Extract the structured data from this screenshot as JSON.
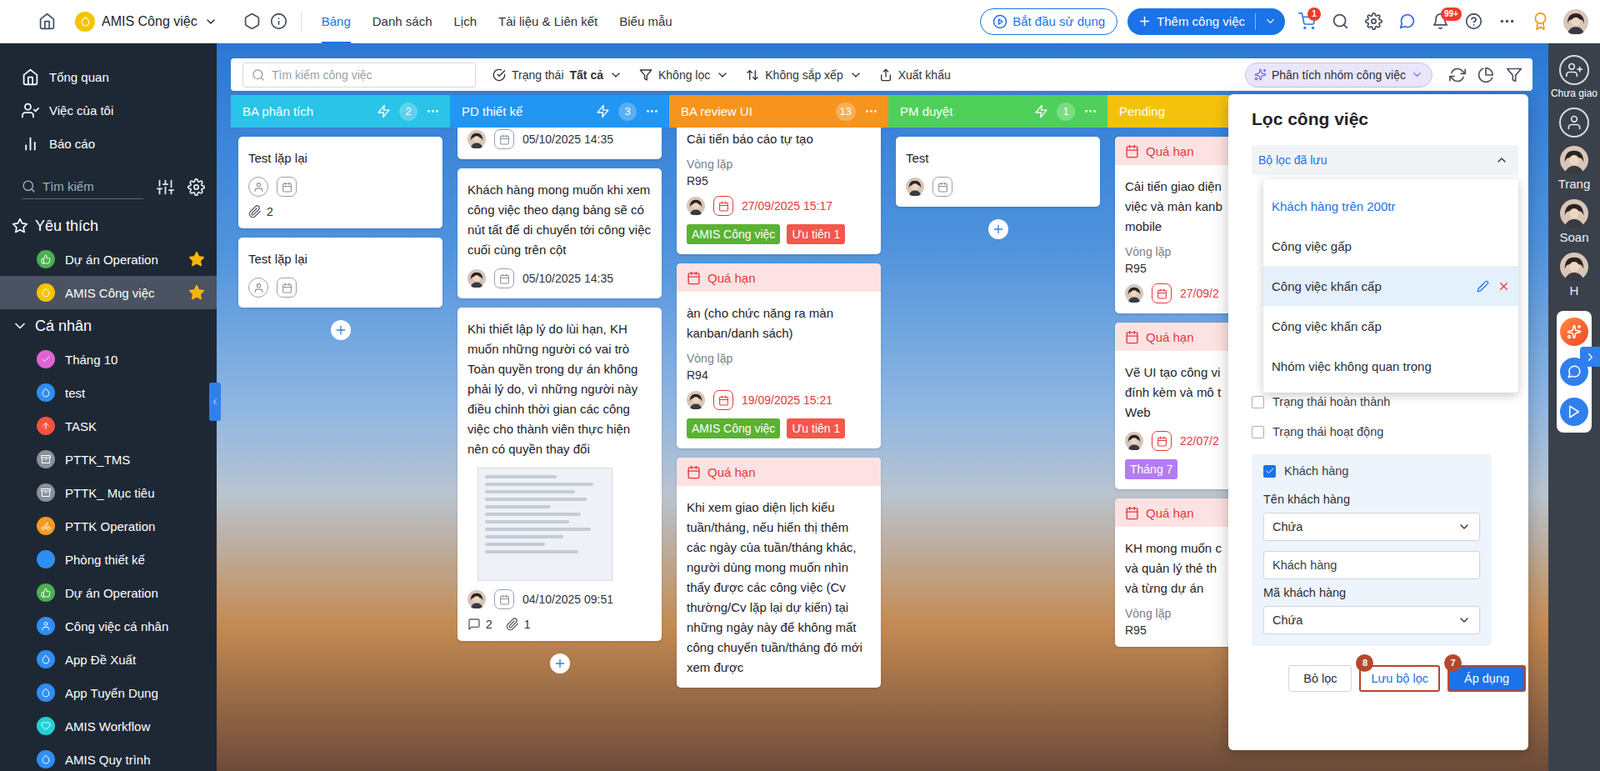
{
  "topbar": {
    "app_name": "AMIS Công việc",
    "tabs": [
      {
        "label": "Bảng",
        "selected": true
      },
      {
        "label": "Danh sách",
        "selected": false
      },
      {
        "label": "Lịch",
        "selected": false
      },
      {
        "label": "Tài liệu & Liên kết",
        "selected": false
      },
      {
        "label": "Biểu mẫu",
        "selected": false
      }
    ],
    "start_button": "Bắt đầu sử dụng",
    "add_button": "Thêm công việc",
    "cart_badge": "1",
    "notification_badge": "99+"
  },
  "sidebar": {
    "nav": [
      {
        "label": "Tổng quan",
        "kind": "home",
        "selected": false
      },
      {
        "label": "Việc của tôi",
        "kind": "mine",
        "selected": false
      },
      {
        "label": "Báo cáo",
        "kind": "report",
        "selected": false
      }
    ],
    "search_placeholder": "Tìm kiếm",
    "favorites": {
      "title": "Yêu thích",
      "items": [
        {
          "label": "Dự án Operation",
          "kind": "thumb",
          "color": "#4caf50",
          "starred": true,
          "selected": false
        },
        {
          "label": "AMIS Công việc",
          "kind": "drop",
          "color": "#f5c400",
          "starred": true,
          "selected": true
        }
      ]
    },
    "personal": {
      "title": "Cá nhân",
      "expanded": true,
      "items": [
        {
          "label": "Tháng 10",
          "kind": "check",
          "color": "#e062d6",
          "selected": false
        },
        {
          "label": "test",
          "kind": "drop",
          "color": "#2f8ef4",
          "selected": false
        },
        {
          "label": "TASK",
          "kind": "up",
          "color": "#f4533f",
          "selected": false
        },
        {
          "label": "PTTK_TMS",
          "kind": "box",
          "color": "#8b919b",
          "selected": false
        },
        {
          "label": "PTTK_ Mục tiêu",
          "kind": "box",
          "color": "#8b919b",
          "selected": false
        },
        {
          "label": "PTTK Operation",
          "kind": "bike",
          "color": "#f59a23",
          "selected": false
        },
        {
          "label": "Phòng thiết kế",
          "kind": "dot",
          "color": "#2f8ef4",
          "selected": false
        },
        {
          "label": "Dự án Operation",
          "kind": "thumb",
          "color": "#4caf50",
          "selected": false
        },
        {
          "label": "Công việc cá nhân",
          "kind": "person",
          "color": "#2f8ef4",
          "selected": false
        },
        {
          "label": "App Đề Xuất",
          "kind": "drop",
          "color": "#2f8ef4",
          "selected": false
        },
        {
          "label": "App Tuyển Dụng",
          "kind": "drop",
          "color": "#2f8ef4",
          "selected": false
        },
        {
          "label": "AMIS Workflow",
          "kind": "heart",
          "color": "#22cfd6",
          "selected": false
        },
        {
          "label": "AMIS Quy trình",
          "kind": "drop",
          "color": "#2f8ef4",
          "selected": false
        }
      ]
    }
  },
  "toolbar": {
    "search_placeholder": "Tìm kiếm công việc",
    "status_label": "Trạng thái",
    "status_value": "Tất cả",
    "filter": "Không lọc",
    "sort": "Không sắp xếp",
    "export": "Xuất khẩu",
    "analysis": "Phân tích nhóm công việc"
  },
  "columns": [
    {
      "title": "BA phân tích",
      "color": "#29c4e8",
      "automation": true,
      "count": "2",
      "add_button": true,
      "cards": [
        {
          "title": "Test lặp lại",
          "assignee": false,
          "attachments": "2"
        },
        {
          "title": "Test lặp lại",
          "assignee": false
        }
      ]
    },
    {
      "title": "PD thiết kế",
      "color": "#2196f3",
      "automation": true,
      "count": "3",
      "add_button": true,
      "cards": [
        {
          "cut_top": true,
          "assignee": true,
          "date": "05/10/2025 14:35",
          "date_overdue": false
        },
        {
          "title": "Khách hàng mong muốn khi xem công việc theo dạng bảng sẽ có nút tất để di chuyển tới công việc cuối cùng trên cột",
          "assignee": true,
          "date": "05/10/2025 14:35",
          "date_overdue": false
        },
        {
          "title": "Khi thiết lập lý do lùi hạn, KH muốn những người có vai trò Toàn quyền trong dự án không phải lý do, vì những người này điều chỉnh thời gian các công việc cho thành viên thực hiện nên có quyền thay đổi",
          "image": true,
          "assignee": true,
          "date": "04/10/2025 09:51",
          "date_overdue": false,
          "comments": "2",
          "attachments": "1"
        }
      ]
    },
    {
      "title": "BA review UI",
      "color": "#f7941d",
      "automation": false,
      "count": "13",
      "add_button": false,
      "cards": [
        {
          "cut_top": true,
          "title": "Cải tiến báo cáo tự tạo",
          "repeat_label": "Vòng lặp",
          "repeat_value": "R95",
          "assignee": true,
          "date": "27/09/2025 15:17",
          "date_overdue": true,
          "tags": [
            {
              "label": "AMIS Công việc",
              "color": "#5bb131"
            },
            {
              "label": "Ưu tiên 1",
              "color": "#f4574c"
            }
          ]
        },
        {
          "overdue_label": "Quá hạn",
          "title": "àn  (cho chức năng ra màn kanban/danh sách)",
          "repeat_label": "Vòng lặp",
          "repeat_value": "R94",
          "assignee": true,
          "date": "19/09/2025 15:21",
          "date_overdue": true,
          "tags": [
            {
              "label": "AMIS Công việc",
              "color": "#5bb131"
            },
            {
              "label": "Ưu tiên 1",
              "color": "#f4574c"
            }
          ]
        },
        {
          "overdue_label": "Quá hạn",
          "title": "Khi xem giao diện lịch kiểu tuần/tháng, nếu hiển thị thêm các ngày của tuần/tháng khác, người dùng mong muốn nhìn thấy được các công việc (Cv thường/Cv lặp lại dự kiến) tại những ngày này để không mất công chuyển tuần/tháng đó mới xem được"
        }
      ]
    },
    {
      "title": "PM duyệt",
      "color": "#4fd05a",
      "automation": true,
      "count": "1",
      "add_button": true,
      "cards": [
        {
          "title": "Test",
          "assignee": true
        }
      ]
    },
    {
      "title": "Pending",
      "color": "#f4c20d",
      "automation": false,
      "add_button": false,
      "cards": [
        {
          "overdue_label": "Quá hạn",
          "title_lines": [
            "Cải tiến giao diện",
            "việc và màn kanb",
            "mobile"
          ],
          "repeat_label": "Vòng lặp",
          "repeat_value": "R95",
          "assignee": true,
          "date": "27/09/2",
          "date_overdue": true
        },
        {
          "overdue_label": "Quá hạn",
          "title_lines": [
            "Vẽ UI tạo công vi",
            "đính kèm và mô t",
            "Web"
          ],
          "assignee": true,
          "date": "22/07/2",
          "date_overdue": true,
          "tags": [
            {
              "label": "Tháng 7",
              "color": "#b37cf0"
            }
          ]
        },
        {
          "overdue_label": "Quá hạn",
          "title_lines": [
            "KH mong muốn c",
            "và quản lý thẻ th",
            "và từng dự án"
          ],
          "repeat_label": "Vòng lặp",
          "repeat_value": "R95"
        }
      ]
    }
  ],
  "filter_panel": {
    "title": "Lọc công việc",
    "saved": {
      "label": "Bộ lọc đã lưu",
      "expanded": true,
      "items": [
        {
          "label": "Khách hàng trên 200tr",
          "applied": true,
          "hovered": false
        },
        {
          "label": "Công việc gấp",
          "applied": false,
          "hovered": false
        },
        {
          "label": "Công việc khẩn cấp",
          "applied": false,
          "hovered": true
        },
        {
          "label": "Công việc khẩn cấp",
          "applied": false,
          "hovered": false
        },
        {
          "label": "Nhóm việc không quan trọng",
          "applied": false,
          "hovered": false
        }
      ]
    },
    "conditions": [
      {
        "label": "Trạng thái hoàn thành",
        "checked": false
      },
      {
        "label": "Trạng thái hoạt động",
        "checked": false
      },
      {
        "label": "Khách hàng",
        "checked": true,
        "fields": [
          {
            "label": "Tên khách hàng",
            "operator": "Chứa",
            "value": "Khách hàng"
          },
          {
            "label": "Mã khách hàng",
            "operator": "Chứa"
          }
        ]
      }
    ],
    "buttons": [
      {
        "label": "Bỏ lọc",
        "kind": "plain"
      },
      {
        "label": "Lưu bộ lọc",
        "kind": "outline",
        "badge": "8"
      },
      {
        "label": "Áp dụng",
        "kind": "primary",
        "badge": "7"
      }
    ]
  },
  "right_panel": {
    "unassigned_label": "Chưa giao",
    "members": [
      {
        "name": "Trang"
      },
      {
        "name": "Soan"
      },
      {
        "name": "H"
      }
    ]
  }
}
